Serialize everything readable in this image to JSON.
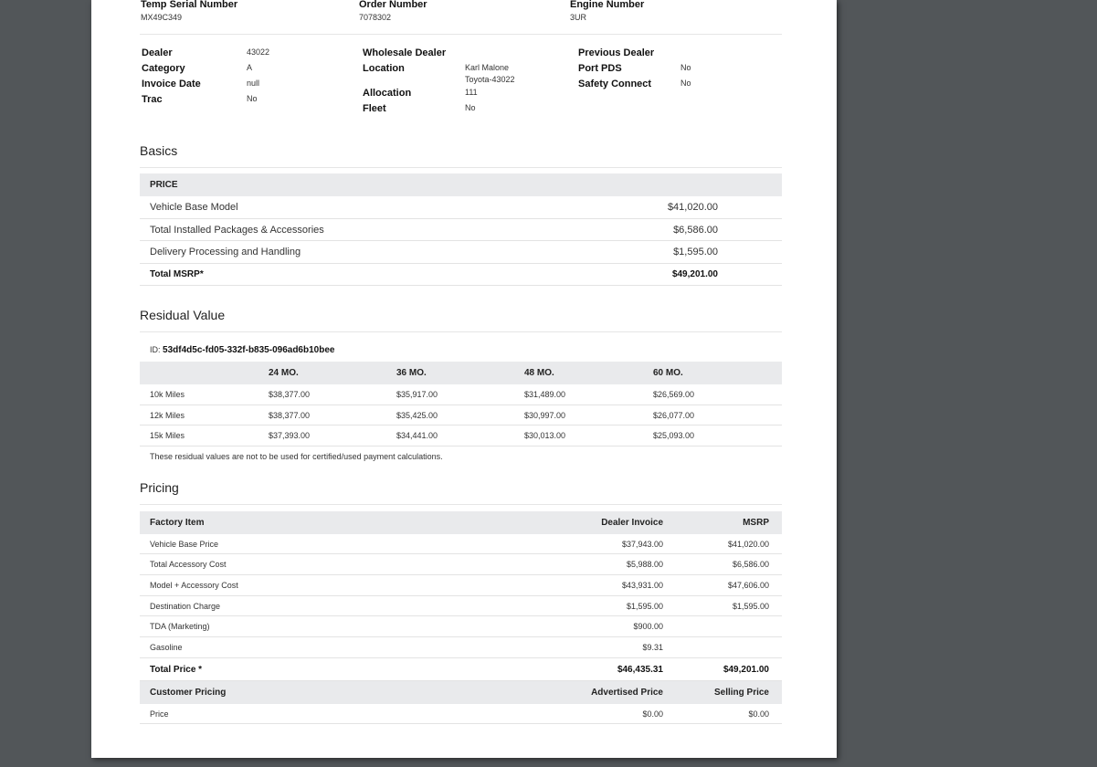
{
  "header": {
    "temp_serial": {
      "label": "Temp Serial Number",
      "value": "MX49C349"
    },
    "order_number": {
      "label": "Order Number",
      "value": "7078302"
    },
    "engine_number": {
      "label": "Engine Number",
      "value": "3UR"
    }
  },
  "details": {
    "col1": [
      {
        "label": "Dealer",
        "value": "43022"
      },
      {
        "label": "Category",
        "value": "A"
      },
      {
        "label": "Invoice Date",
        "value": "null"
      },
      {
        "label": "Trac",
        "value": "No"
      }
    ],
    "col2": {
      "wholesale_dealer": {
        "label": "Wholesale Dealer",
        "value": ""
      },
      "location": {
        "label": "Location",
        "value_line1": "Karl Malone",
        "value_line2": "Toyota-43022"
      },
      "allocation": {
        "label": "Allocation",
        "value": "111"
      },
      "fleet": {
        "label": "Fleet",
        "value": "No"
      }
    },
    "col3": [
      {
        "label": "Previous Dealer",
        "value": ""
      },
      {
        "label": "Port PDS",
        "value": "No"
      },
      {
        "label": "Safety Connect",
        "value": "No"
      }
    ]
  },
  "basics": {
    "title": "Basics",
    "band_label": "PRICE",
    "rows": [
      {
        "label": "Vehicle Base Model",
        "value": "$41,020.00"
      },
      {
        "label": "Total Installed Packages & Accessories",
        "value": "$6,586.00"
      },
      {
        "label": "Delivery Processing and Handling",
        "value": "$1,595.00"
      },
      {
        "label": "Total MSRP*",
        "value": "$49,201.00"
      }
    ]
  },
  "residual": {
    "title": "Residual Value",
    "id_label": "ID:",
    "id_value": "53df4d5c-fd05-332f-b835-096ad6b10bee",
    "columns": [
      "24 MO.",
      "36 MO.",
      "48 MO.",
      "60 MO."
    ],
    "rows": [
      {
        "label": "10k Miles",
        "values": [
          "$38,377.00",
          "$35,917.00",
          "$31,489.00",
          "$26,569.00"
        ]
      },
      {
        "label": "12k Miles",
        "values": [
          "$38,377.00",
          "$35,425.00",
          "$30,997.00",
          "$26,077.00"
        ]
      },
      {
        "label": "15k Miles",
        "values": [
          "$37,393.00",
          "$34,441.00",
          "$30,013.00",
          "$25,093.00"
        ]
      }
    ],
    "note": "These residual values are not to be used for certified/used payment calculations."
  },
  "pricing": {
    "title": "Pricing",
    "header": {
      "item": "Factory Item",
      "invoice": "Dealer Invoice",
      "msrp": "MSRP"
    },
    "rows": [
      {
        "label": "Vehicle Base Price",
        "invoice": "$37,943.00",
        "msrp": "$41,020.00"
      },
      {
        "label": "Total Accessory Cost",
        "invoice": "$5,988.00",
        "msrp": "$6,586.00"
      },
      {
        "label": "Model + Accessory Cost",
        "invoice": "$43,931.00",
        "msrp": "$47,606.00"
      },
      {
        "label": "Destination Charge",
        "invoice": "$1,595.00",
        "msrp": "$1,595.00"
      },
      {
        "label": "TDA (Marketing)",
        "invoice": "$900.00",
        "msrp": ""
      },
      {
        "label": "Gasoline",
        "invoice": "$9.31",
        "msrp": ""
      }
    ],
    "total": {
      "label": "Total Price  *",
      "invoice": "$46,435.31",
      "msrp": "$49,201.00"
    },
    "customer_header": {
      "item": "Customer Pricing",
      "advertised": "Advertised Price",
      "selling": "Selling Price"
    },
    "customer_rows": [
      {
        "label": "Price",
        "advertised": "$0.00",
        "selling": "$0.00"
      }
    ]
  }
}
